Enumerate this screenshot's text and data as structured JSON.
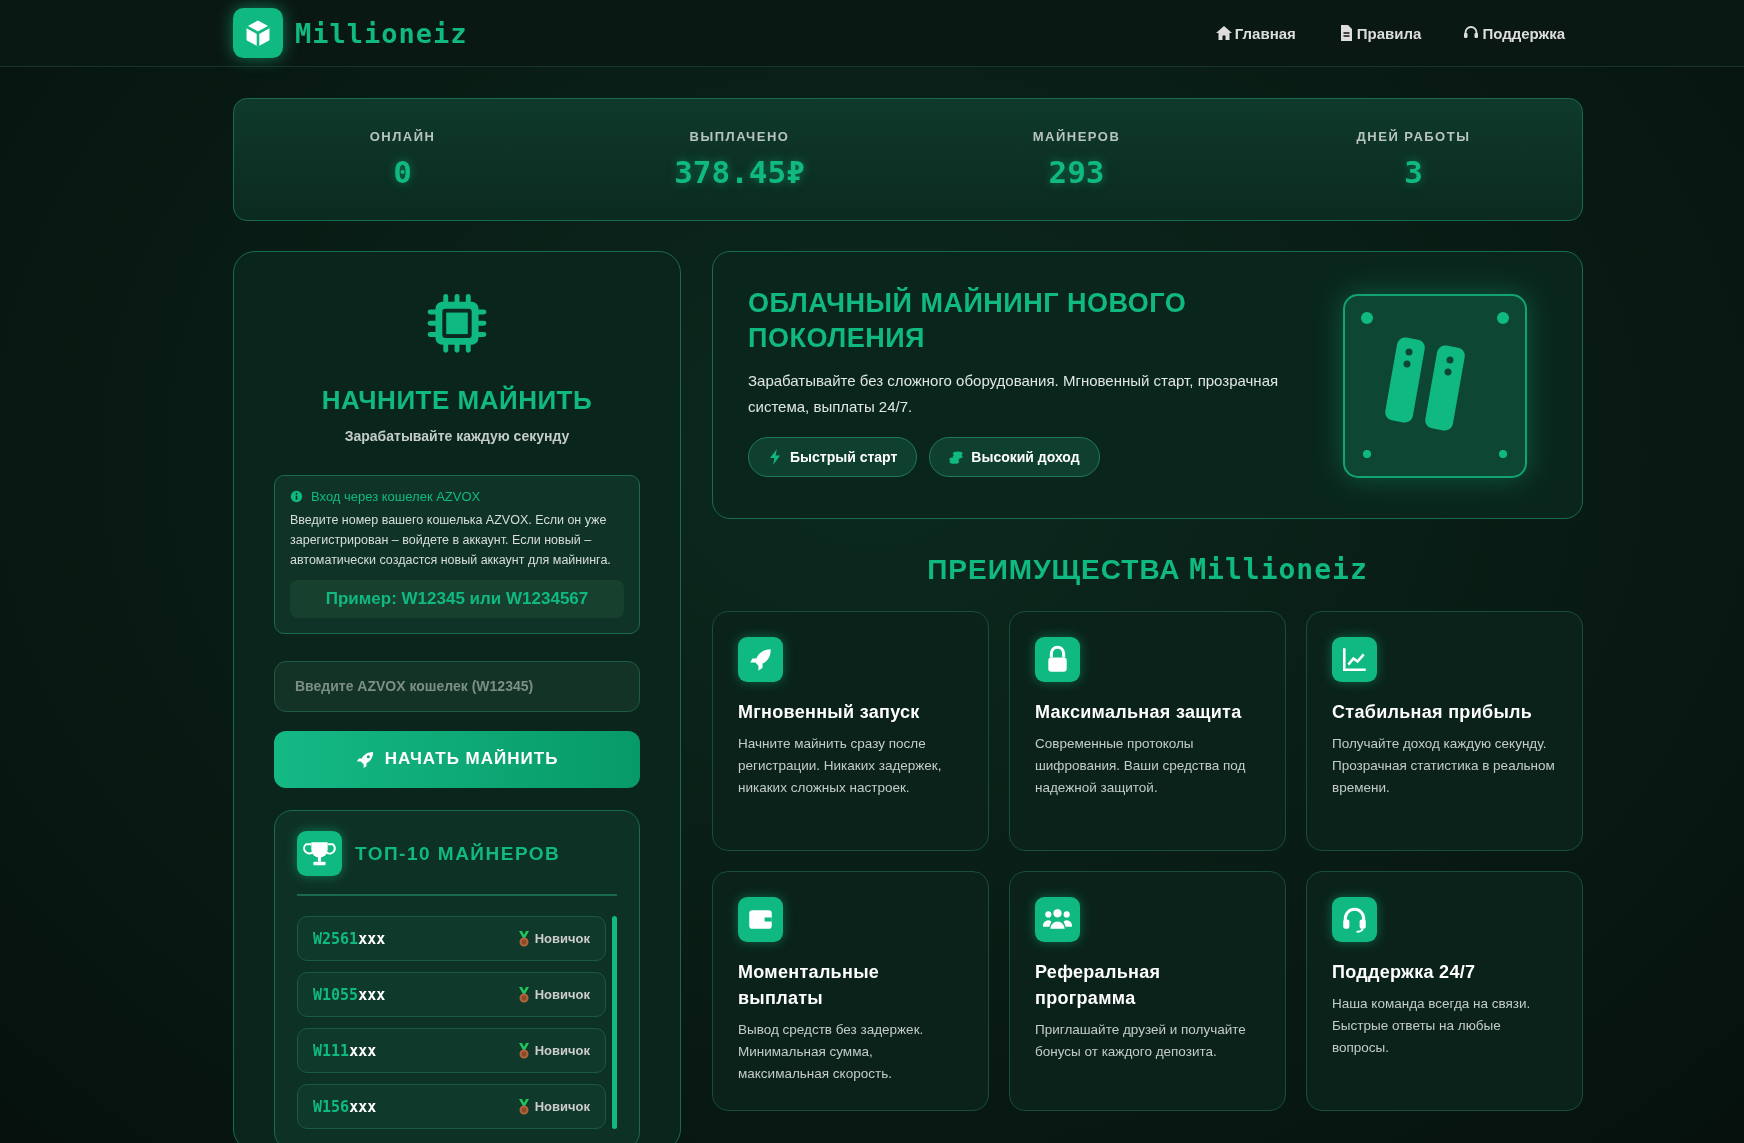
{
  "header": {
    "logo": "Millioneiz",
    "nav": [
      {
        "label": "Главная",
        "kind": "home"
      },
      {
        "label": "Правила",
        "kind": "file"
      },
      {
        "label": "Поддержка",
        "kind": "headset"
      }
    ]
  },
  "stats": [
    {
      "label": "ОНЛАЙН",
      "value": "0"
    },
    {
      "label": "ВЫПЛАЧЕНО",
      "value": "378.45₽"
    },
    {
      "label": "МАЙНЕРОВ",
      "value": "293"
    },
    {
      "label": "ДНЕЙ РАБОТЫ",
      "value": "3"
    }
  ],
  "login": {
    "title": "НАЧНИТЕ МАЙНИТЬ",
    "subtitle": "Зарабатывайте каждую секунду",
    "info_title": "Вход через кошелек AZVOX",
    "info_text": "Введите номер вашего кошелька AZVOX. Если он уже зарегистрирован – войдете в аккаунт. Если новый – автоматически создастся новый аккаунт для майнинга.",
    "example": "Пример: W12345 или W1234567",
    "placeholder": "Введите AZVOX кошелек (W12345)",
    "button": "НАЧАТЬ МАЙНИТЬ"
  },
  "top_miners": {
    "title": "ТОП-10 МАЙНЕРОВ",
    "rows": [
      {
        "id": "W2561",
        "mask": "xxx",
        "rank": "Новичок"
      },
      {
        "id": "W1055",
        "mask": "xxx",
        "rank": "Новичок"
      },
      {
        "id": "W111",
        "mask": "xxx",
        "rank": "Новичок"
      },
      {
        "id": "W156",
        "mask": "xxx",
        "rank": "Новичок"
      }
    ]
  },
  "hero": {
    "title": "ОБЛАЧНЫЙ МАЙНИНГ НОВОГО ПОКОЛЕНИЯ",
    "text": "Зарабатывайте без сложного оборудования. Мгновенный старт, прозрачная система, выплаты 24/7.",
    "badges": [
      {
        "label": "Быстрый старт",
        "kind": "bolt"
      },
      {
        "label": "Высокий доход",
        "kind": "coins"
      }
    ]
  },
  "advantages": {
    "title": "ПРЕИМУЩЕСТВА",
    "brand": "Millioneiz",
    "features": [
      {
        "kind": "rocket",
        "title": "Мгновенный запуск",
        "text": "Начните майнить сразу после регистрации. Никаких задержек, никаких сложных настроек."
      },
      {
        "kind": "lock",
        "title": "Максимальная защита",
        "text": "Современные протоколы шифрования. Ваши средства под надежной защитой."
      },
      {
        "kind": "chart",
        "title": "Стабильная прибыль",
        "text": "Получайте доход каждую секунду. Прозрачная статистика в реальном времени."
      },
      {
        "kind": "wallet",
        "title": "Моментальные выплаты",
        "text": "Вывод средств без задержек. Минимальная сумма, максимальная скорость."
      },
      {
        "kind": "users",
        "title": "Реферальная программа",
        "text": "Приглашайте друзей и получайте бонусы от каждого депозита."
      },
      {
        "kind": "headset",
        "title": "Поддержка 24/7",
        "text": "Наша команда всегда на связи. Быстрые ответы на любые вопросы."
      }
    ]
  }
}
